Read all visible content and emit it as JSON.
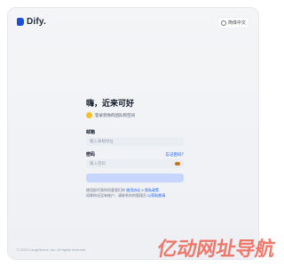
{
  "brand": {
    "name": "Dify."
  },
  "header": {
    "language_label": "简体中文"
  },
  "login": {
    "title": "嗨，近来可好",
    "subtitle": "登录到你的团队和空间",
    "email": {
      "label": "邮箱",
      "placeholder": "输入邮箱地址"
    },
    "password": {
      "label": "密码",
      "forgot_link": "忘记密码？",
      "placeholder": "输入密码"
    },
    "terms_line_1_prefix": "使用即代表你同意我们的",
    "terms_link_1": "使用协议",
    "terms_and": "&",
    "terms_link_2": "隐私政策",
    "terms_line_2_prefix": "如果你还没有账户，请联系你的管理员",
    "terms_line_2_link": "以获取邀请"
  },
  "footer": {
    "copyright": "© 2023 LangGenius, Inc. All rights reserved."
  },
  "watermark": {
    "text": "亿动网址导航"
  }
}
